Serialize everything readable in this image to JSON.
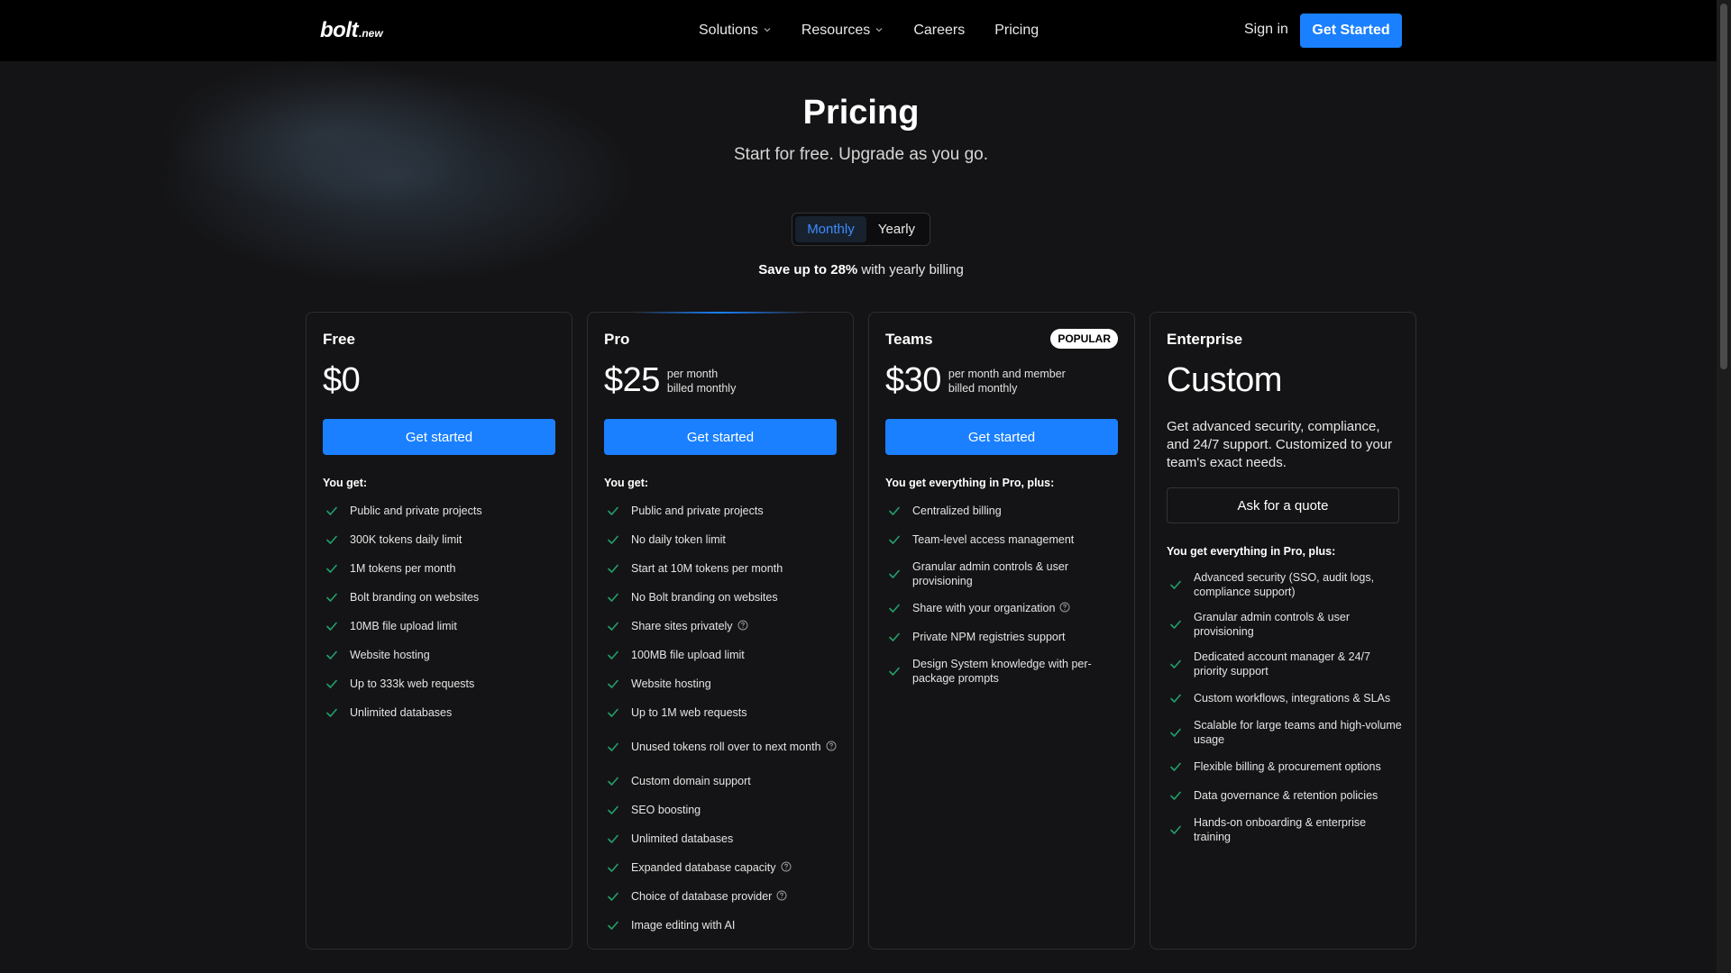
{
  "header": {
    "logo_main": "bolt",
    "logo_sub": ".new",
    "nav": [
      {
        "label": "Solutions",
        "dropdown": true
      },
      {
        "label": "Resources",
        "dropdown": true
      },
      {
        "label": "Careers",
        "dropdown": false
      },
      {
        "label": "Pricing",
        "dropdown": false
      }
    ],
    "sign_in": "Sign in",
    "get_started": "Get Started"
  },
  "hero": {
    "title": "Pricing",
    "subtitle": "Start for free. Upgrade as you go.",
    "toggle": {
      "monthly": "Monthly",
      "yearly": "Yearly",
      "selected": "Monthly"
    },
    "save_prefix": "Save up to 28%",
    "save_suffix": " with yearly billing"
  },
  "colors": {
    "accent": "#1a80ff",
    "background": "#141416",
    "header": "#000000",
    "check": "#22a06b"
  },
  "plans": [
    {
      "name": "Free",
      "price": "$0",
      "price_note_1": "",
      "price_note_2": "",
      "cta": "Get started",
      "features_heading": "You get:",
      "features": [
        {
          "text": "Public and private projects"
        },
        {
          "text": "300K tokens daily limit"
        },
        {
          "text": "1M tokens per month"
        },
        {
          "text": "Bolt branding on websites"
        },
        {
          "text": "10MB file upload limit"
        },
        {
          "text": "Website hosting"
        },
        {
          "text": "Up to 333k web requests"
        },
        {
          "text": "Unlimited databases"
        }
      ]
    },
    {
      "name": "Pro",
      "price": "$25",
      "price_note_1": "per month",
      "price_note_2": "billed monthly",
      "cta": "Get started",
      "features_heading": "You get:",
      "features": [
        {
          "text": "Public and private projects"
        },
        {
          "text": "No daily token limit"
        },
        {
          "text": "Start at 10M tokens per month"
        },
        {
          "text": "No Bolt branding on websites"
        },
        {
          "text": "Share sites privately",
          "info": true
        },
        {
          "text": "100MB file upload limit"
        },
        {
          "text": "Website hosting"
        },
        {
          "text": "Up to 1M web requests"
        },
        {
          "text": "Unused tokens roll over to next month",
          "info": true,
          "tall": true
        },
        {
          "text": "Custom domain support"
        },
        {
          "text": "SEO boosting"
        },
        {
          "text": "Unlimited databases"
        },
        {
          "text": "Expanded database capacity",
          "info": true
        },
        {
          "text": "Choice of database provider",
          "info": true
        },
        {
          "text": "Image editing with AI"
        }
      ]
    },
    {
      "name": "Teams",
      "badge": "POPULAR",
      "price": "$30",
      "price_note_1": "per month and member",
      "price_note_2": "billed monthly",
      "cta": "Get started",
      "features_heading": "You get everything in Pro, plus:",
      "features": [
        {
          "text": "Centralized billing"
        },
        {
          "text": "Team-level access management"
        },
        {
          "text": "Granular admin controls & user provisioning",
          "tall": true
        },
        {
          "text": "Share with your organization",
          "info": true
        },
        {
          "text": "Private NPM registries support"
        },
        {
          "text": "Design System knowledge with per-package prompts",
          "tall": true
        }
      ]
    },
    {
      "name": "Enterprise",
      "price": "Custom",
      "description": "Get advanced security, compliance, and 24/7 support. Customized to your team's exact needs.",
      "cta": "Ask for a quote",
      "features_heading": "You get everything in Pro, plus:",
      "features": [
        {
          "text": "Advanced security (SSO, audit logs, compliance support)",
          "tall": true
        },
        {
          "text": "Granular admin controls & user provisioning",
          "tall": true
        },
        {
          "text": "Dedicated account manager & 24/7 priority support",
          "tall": true
        },
        {
          "text": "Custom workflows, integrations & SLAs"
        },
        {
          "text": "Scalable for large teams and high-volume usage",
          "tall": true
        },
        {
          "text": "Flexible billing & procurement options"
        },
        {
          "text": "Data governance & retention policies"
        },
        {
          "text": "Hands-on onboarding & enterprise training",
          "tall": true
        }
      ]
    }
  ]
}
